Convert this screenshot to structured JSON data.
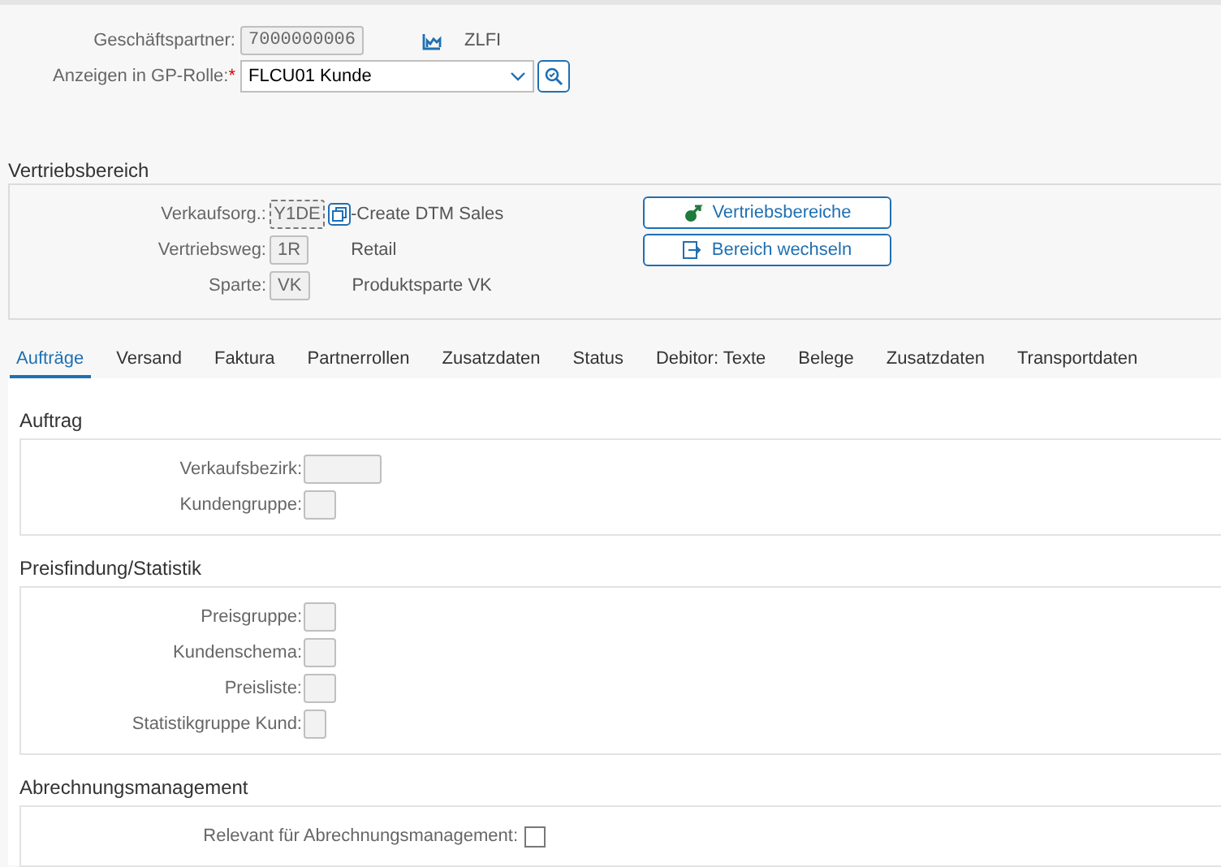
{
  "partner": {
    "label": "Geschäftspartner:",
    "value": "7000000006",
    "description": "ZLFI"
  },
  "role": {
    "label": "Anzeigen in GP-Rolle:",
    "required_mark": "*",
    "value": "FLCU01 Kunde"
  },
  "sales_area": {
    "title": "Vertriebsbereich",
    "fields": [
      {
        "label": "Verkaufsorg.:",
        "value": "Y1DE",
        "description": "-Create DTM Sales",
        "focused": true
      },
      {
        "label": "Vertriebsweg:",
        "value": "1R",
        "description": "Retail",
        "focused": false
      },
      {
        "label": "Sparte:",
        "value": "VK",
        "description": "Produktsparte VK",
        "focused": false
      }
    ],
    "buttons": [
      {
        "label": "Vertriebsbereiche",
        "kind": "areas"
      },
      {
        "label": "Bereich wechseln",
        "kind": "switch"
      }
    ]
  },
  "tabs": [
    {
      "label": "Aufträge",
      "selected": true
    },
    {
      "label": "Versand",
      "selected": false
    },
    {
      "label": "Faktura",
      "selected": false
    },
    {
      "label": "Partnerrollen",
      "selected": false
    },
    {
      "label": "Zusatzdaten",
      "selected": false
    },
    {
      "label": "Status",
      "selected": false
    },
    {
      "label": "Debitor: Texte",
      "selected": false
    },
    {
      "label": "Belege",
      "selected": false
    },
    {
      "label": "Zusatzdaten",
      "selected": false
    },
    {
      "label": "Transportdaten",
      "selected": false
    }
  ],
  "sections": [
    {
      "title": "Auftrag",
      "fields": [
        {
          "label": "Verkaufsbezirk:",
          "kind": "wide"
        },
        {
          "label": "Kundengruppe:",
          "kind": "short"
        }
      ]
    },
    {
      "title": "Preisfindung/Statistik",
      "fields": [
        {
          "label": "Preisgruppe:",
          "kind": "short"
        },
        {
          "label": "Kundenschema:",
          "kind": "short"
        },
        {
          "label": "Preisliste:",
          "kind": "short"
        },
        {
          "label": "Statistikgruppe Kund:",
          "kind": "tiny"
        }
      ]
    },
    {
      "title": "Abrechnungsmanagement",
      "fields": [
        {
          "label": "Relevant für Abrechnungsmanagement:",
          "kind": "checkbox",
          "checked": false
        }
      ]
    }
  ]
}
